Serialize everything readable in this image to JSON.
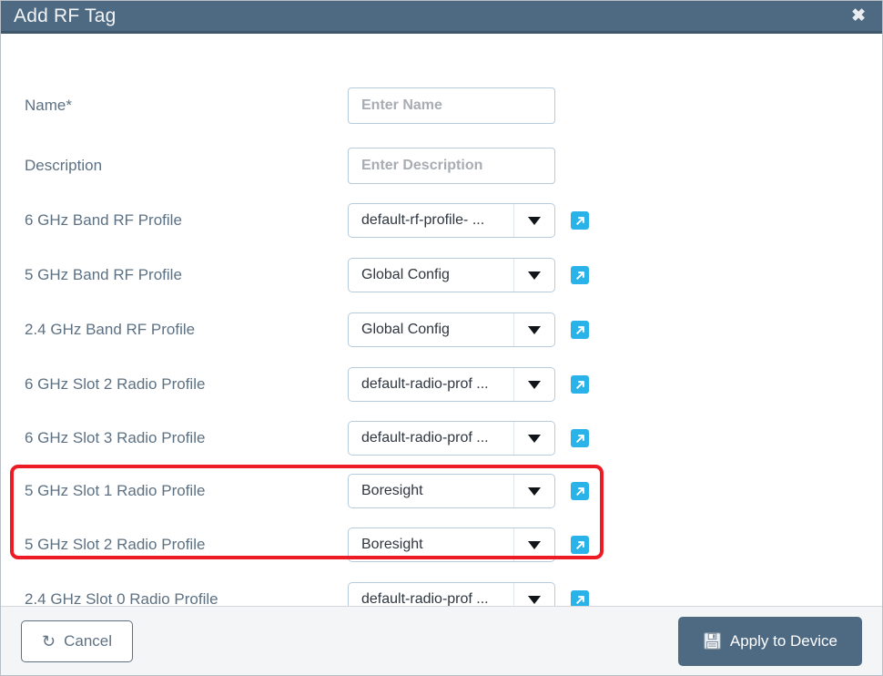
{
  "dialog": {
    "title": "Add RF Tag",
    "close_icon": "close-icon"
  },
  "fields": [
    {
      "label": "Name*",
      "type": "text",
      "value": "",
      "placeholder": "Enter Name",
      "has_link": false
    },
    {
      "label": "Description",
      "type": "text",
      "value": "",
      "placeholder": "Enter Description",
      "has_link": false
    },
    {
      "label": "6 GHz Band RF Profile",
      "type": "select",
      "value": "default-rf-profile- ...",
      "has_link": true
    },
    {
      "label": "5 GHz Band RF Profile",
      "type": "select",
      "value": "Global Config",
      "has_link": true
    },
    {
      "label": "2.4 GHz Band RF Profile",
      "type": "select",
      "value": "Global Config",
      "has_link": true
    },
    {
      "label": "6 GHz Slot 2 Radio Profile",
      "type": "select",
      "value": "default-radio-prof ...",
      "has_link": true
    },
    {
      "label": "6 GHz Slot 3 Radio Profile",
      "type": "select",
      "value": "default-radio-prof ...",
      "has_link": true
    },
    {
      "label": "5 GHz Slot 1 Radio Profile",
      "type": "select",
      "value": "Boresight",
      "has_link": true
    },
    {
      "label": "5 GHz Slot 2 Radio Profile",
      "type": "select",
      "value": "Boresight",
      "has_link": true
    },
    {
      "label": "2.4 GHz Slot 0 Radio Profile",
      "type": "select",
      "value": "default-radio-prof ...",
      "has_link": true
    }
  ],
  "footer": {
    "cancel_label": "Cancel",
    "apply_label": "Apply to Device"
  },
  "colors": {
    "header_bg": "#4e6a82",
    "label_text": "#5d7183",
    "link_icon": "#29b3e8",
    "highlight": "#ed1c24",
    "primary_button": "#4e6a82"
  }
}
